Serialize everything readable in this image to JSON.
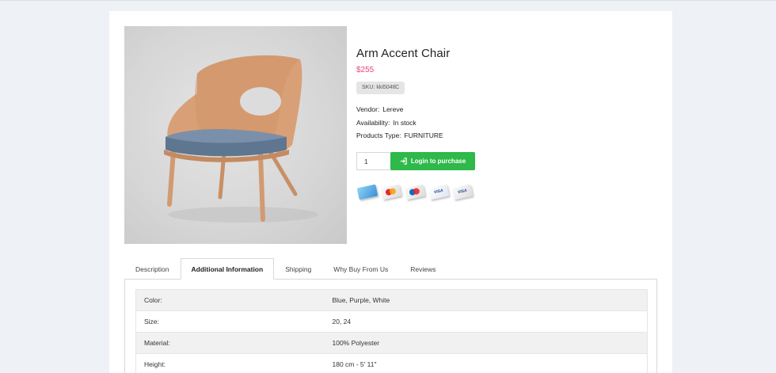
{
  "product": {
    "title": "Arm Accent Chair",
    "price": "$255",
    "sku_label": "SKU:",
    "sku_value": "kki504tlC",
    "vendor_label": "Vendor:",
    "vendor_value": "Lereve",
    "availability_label": "Availability:",
    "availability_value": "In stock",
    "type_label": "Products Type:",
    "type_value": "FURNITURE",
    "quantity": "1",
    "buy_button_label": "Login to purchase",
    "image_icon": "chair-photo"
  },
  "payments": [
    {
      "name": "amex-card-icon",
      "label": ""
    },
    {
      "name": "mastercard-card-icon",
      "label": ""
    },
    {
      "name": "maestro-card-icon",
      "label": ""
    },
    {
      "name": "visa-card-icon",
      "label": "VISA"
    },
    {
      "name": "visa-electron-card-icon",
      "label": "VISA"
    }
  ],
  "tabs": [
    {
      "label": "Description"
    },
    {
      "label": "Additional Information",
      "active": true
    },
    {
      "label": "Shipping"
    },
    {
      "label": "Why Buy From Us"
    },
    {
      "label": "Reviews"
    }
  ],
  "attributes": [
    {
      "key": "Color:",
      "value": "Blue, Purple, White"
    },
    {
      "key": "Size:",
      "value": "20, 24"
    },
    {
      "key": "Material:",
      "value": "100% Polyester"
    },
    {
      "key": "Height:",
      "value": "180 cm - 5' 11\""
    }
  ],
  "colors": {
    "price": "#e8457a",
    "buy_button": "#2eb94a",
    "page_bg": "#eef1f5"
  }
}
